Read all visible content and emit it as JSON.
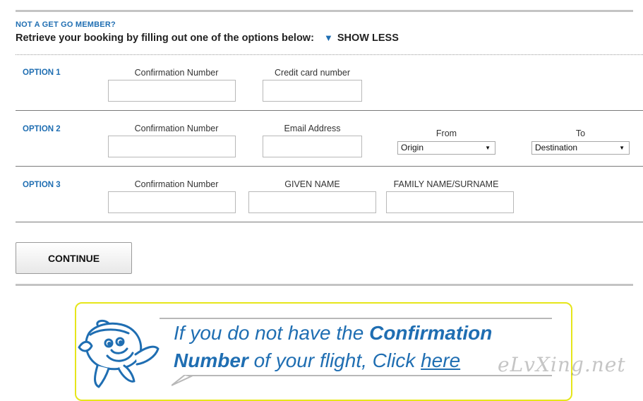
{
  "header": {
    "eyebrow": "NOT A GET GO MEMBER?",
    "instruction": "Retrieve your booking by filling out one of the options below:",
    "toggle_label": "SHOW LESS"
  },
  "options": [
    {
      "label": "OPTION 1",
      "fields": [
        "Confirmation Number",
        "Credit card number"
      ]
    },
    {
      "label": "OPTION 2",
      "fields": [
        "Confirmation Number",
        "Email Address"
      ],
      "from_label": "From",
      "from_value": "Origin",
      "to_label": "To",
      "to_value": "Destination"
    },
    {
      "label": "OPTION 3",
      "fields": [
        "Confirmation Number",
        "GIVEN NAME",
        "FAMILY NAME/SURNAME"
      ]
    }
  ],
  "continue_label": "CONTINUE",
  "promo": {
    "line1_pre": "If you do not have the ",
    "line1_bold": "Confirmation",
    "line2_bold": "Number",
    "line2_mid": " of your flight, Click ",
    "line2_link": "here"
  },
  "watermark": "eLvXing.net",
  "colors": {
    "accent": "#1f6eb2",
    "promo_border": "#e6e61a"
  }
}
